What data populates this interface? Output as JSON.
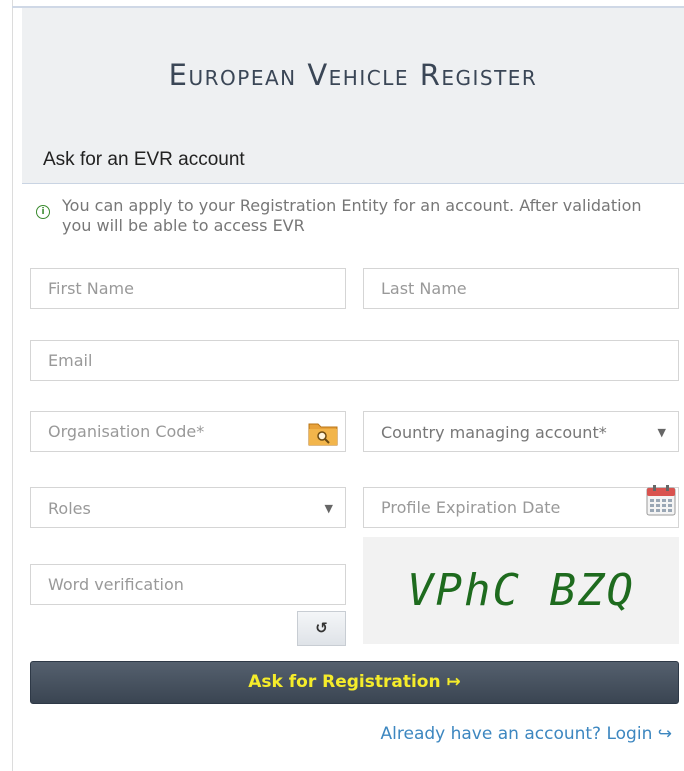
{
  "header": {
    "title": "European Vehicle Register",
    "section_title": "Ask for an EVR account"
  },
  "info": {
    "icon": "info-icon",
    "text": "You can apply to your Registration Entity for an account. After validation you will be able to access EVR"
  },
  "form": {
    "first_name": {
      "placeholder": "First Name",
      "value": ""
    },
    "last_name": {
      "placeholder": "Last Name",
      "value": ""
    },
    "email": {
      "placeholder": "Email",
      "value": ""
    },
    "organisation_code": {
      "placeholder": "Organisation Code*",
      "value": "",
      "icon": "folder-search-icon"
    },
    "country": {
      "selected": "Country managing account*",
      "icon": "chevron-down-icon"
    },
    "roles": {
      "selected": "Roles",
      "icon": "chevron-down-icon"
    },
    "expiration_date": {
      "placeholder": "Profile Expiration Date",
      "value": "",
      "icon": "calendar-icon"
    },
    "word_verification": {
      "placeholder": "Word verification",
      "value": ""
    },
    "refresh_label": "↺",
    "captcha_text": "VPhC BZQ"
  },
  "actions": {
    "submit_label": "Ask for Registration ↦",
    "login_link": "Already have an account? Login ↪"
  },
  "colors": {
    "header_bg": "#eef0f2",
    "submit_bg": "#3a4552",
    "submit_text": "#f5ec2a",
    "link": "#3d87c0",
    "captcha_text": "#1e6b1e",
    "info_icon": "#3a8a2e"
  }
}
